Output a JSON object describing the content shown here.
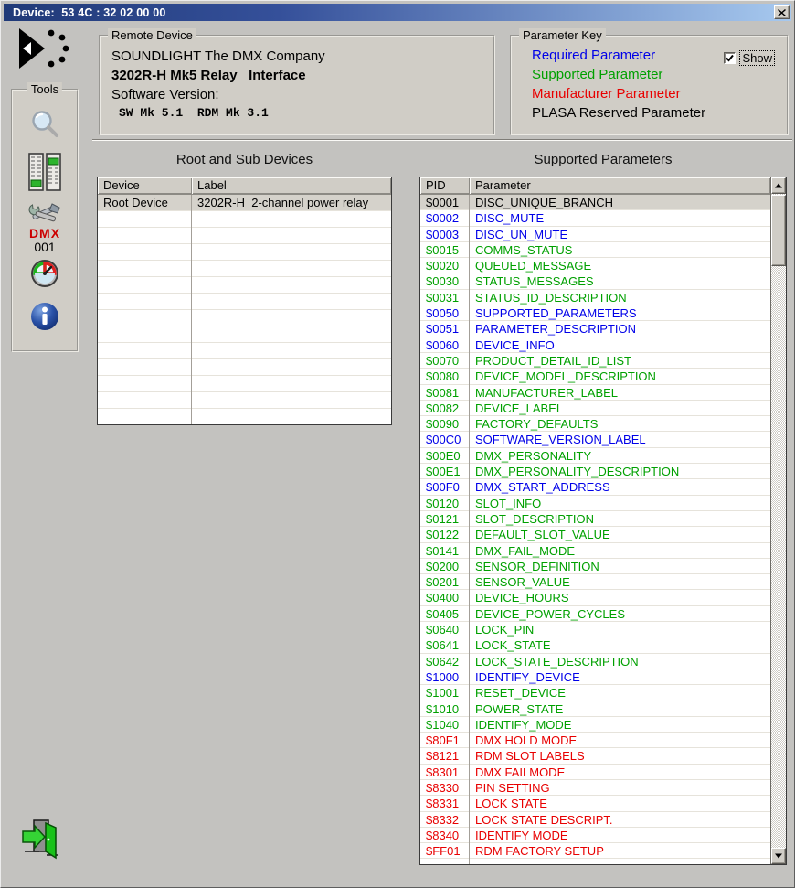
{
  "window": {
    "title": "Device:  53 4C : 32 02 00 00"
  },
  "remote_device": {
    "group_title": "Remote Device",
    "manufacturer": "SOUNDLIGHT The DMX Company",
    "model": "3202R-H Mk5 Relay   Interface",
    "software_version_label": "Software Version:",
    "software_version_value": "SW Mk 5.1  RDM Mk 3.1"
  },
  "parameter_key": {
    "group_title": "Parameter Key",
    "entries": [
      {
        "label": "Required Parameter",
        "type": "required"
      },
      {
        "label": "Supported Parameter",
        "type": "supported"
      },
      {
        "label": "Manufacturer Parameter",
        "type": "manufacturer"
      },
      {
        "label": "PLASA Reserved Parameter",
        "type": "plasa_reserved"
      }
    ],
    "show_label": "Show",
    "show_checked": true
  },
  "tools": {
    "group_title": "Tools",
    "dmx_label": "DMX",
    "dmx_address": "001",
    "icons": [
      "magnifier-icon",
      "faders-icon",
      "dmx-tools-icon",
      "gauge-icon",
      "info-icon"
    ]
  },
  "devices_table": {
    "title": "Root and Sub Devices",
    "columns": [
      "Device",
      "Label"
    ],
    "rows": [
      {
        "device": "Root Device",
        "label": "3202R-H  2-channel power relay",
        "selected": true
      }
    ],
    "empty_row_count": 13
  },
  "parameters_table": {
    "title": "Supported Parameters",
    "columns": [
      "PID",
      "Parameter"
    ],
    "rows": [
      {
        "pid": "$0001",
        "name": "DISC_UNIQUE_BRANCH",
        "type": "required",
        "selected": true
      },
      {
        "pid": "$0002",
        "name": "DISC_MUTE",
        "type": "required"
      },
      {
        "pid": "$0003",
        "name": "DISC_UN_MUTE",
        "type": "required"
      },
      {
        "pid": "$0015",
        "name": "COMMS_STATUS",
        "type": "supported"
      },
      {
        "pid": "$0020",
        "name": "QUEUED_MESSAGE",
        "type": "supported"
      },
      {
        "pid": "$0030",
        "name": "STATUS_MESSAGES",
        "type": "supported"
      },
      {
        "pid": "$0031",
        "name": "STATUS_ID_DESCRIPTION",
        "type": "supported"
      },
      {
        "pid": "$0050",
        "name": "SUPPORTED_PARAMETERS",
        "type": "required"
      },
      {
        "pid": "$0051",
        "name": "PARAMETER_DESCRIPTION",
        "type": "required"
      },
      {
        "pid": "$0060",
        "name": "DEVICE_INFO",
        "type": "required"
      },
      {
        "pid": "$0070",
        "name": "PRODUCT_DETAIL_ID_LIST",
        "type": "supported"
      },
      {
        "pid": "$0080",
        "name": "DEVICE_MODEL_DESCRIPTION",
        "type": "supported"
      },
      {
        "pid": "$0081",
        "name": "MANUFACTURER_LABEL",
        "type": "supported"
      },
      {
        "pid": "$0082",
        "name": "DEVICE_LABEL",
        "type": "supported"
      },
      {
        "pid": "$0090",
        "name": "FACTORY_DEFAULTS",
        "type": "supported"
      },
      {
        "pid": "$00C0",
        "name": "SOFTWARE_VERSION_LABEL",
        "type": "required"
      },
      {
        "pid": "$00E0",
        "name": "DMX_PERSONALITY",
        "type": "supported"
      },
      {
        "pid": "$00E1",
        "name": "DMX_PERSONALITY_DESCRIPTION",
        "type": "supported"
      },
      {
        "pid": "$00F0",
        "name": "DMX_START_ADDRESS",
        "type": "required"
      },
      {
        "pid": "$0120",
        "name": "SLOT_INFO",
        "type": "supported"
      },
      {
        "pid": "$0121",
        "name": "SLOT_DESCRIPTION",
        "type": "supported"
      },
      {
        "pid": "$0122",
        "name": "DEFAULT_SLOT_VALUE",
        "type": "supported"
      },
      {
        "pid": "$0141",
        "name": "DMX_FAIL_MODE",
        "type": "supported"
      },
      {
        "pid": "$0200",
        "name": "SENSOR_DEFINITION",
        "type": "supported"
      },
      {
        "pid": "$0201",
        "name": "SENSOR_VALUE",
        "type": "supported"
      },
      {
        "pid": "$0400",
        "name": "DEVICE_HOURS",
        "type": "supported"
      },
      {
        "pid": "$0405",
        "name": "DEVICE_POWER_CYCLES",
        "type": "supported"
      },
      {
        "pid": "$0640",
        "name": "LOCK_PIN",
        "type": "supported"
      },
      {
        "pid": "$0641",
        "name": "LOCK_STATE",
        "type": "supported"
      },
      {
        "pid": "$0642",
        "name": "LOCK_STATE_DESCRIPTION",
        "type": "supported"
      },
      {
        "pid": "$1000",
        "name": "IDENTIFY_DEVICE",
        "type": "required"
      },
      {
        "pid": "$1001",
        "name": "RESET_DEVICE",
        "type": "supported"
      },
      {
        "pid": "$1010",
        "name": "POWER_STATE",
        "type": "supported"
      },
      {
        "pid": "$1040",
        "name": "IDENTIFY_MODE",
        "type": "supported"
      },
      {
        "pid": "$80F1",
        "name": "DMX HOLD MODE",
        "type": "manufacturer"
      },
      {
        "pid": "$8121",
        "name": "RDM SLOT LABELS",
        "type": "manufacturer"
      },
      {
        "pid": "$8301",
        "name": "DMX FAILMODE",
        "type": "manufacturer"
      },
      {
        "pid": "$8330",
        "name": "PIN SETTING",
        "type": "manufacturer"
      },
      {
        "pid": "$8331",
        "name": "LOCK STATE",
        "type": "manufacturer"
      },
      {
        "pid": "$8332",
        "name": "LOCK STATE DESCRIPT.",
        "type": "manufacturer"
      },
      {
        "pid": "$8340",
        "name": "IDENTIFY MODE",
        "type": "manufacturer"
      },
      {
        "pid": "$FF01",
        "name": "RDM FACTORY SETUP",
        "type": "manufacturer"
      }
    ]
  },
  "colors": {
    "required": "#0000e8",
    "supported": "#00a000",
    "manufacturer": "#e80000",
    "plasa_reserved": "#000000",
    "selected_row_bg": "#d5d2cb",
    "titlebar_start": "#203a78",
    "titlebar_end": "#a7c9ef"
  }
}
